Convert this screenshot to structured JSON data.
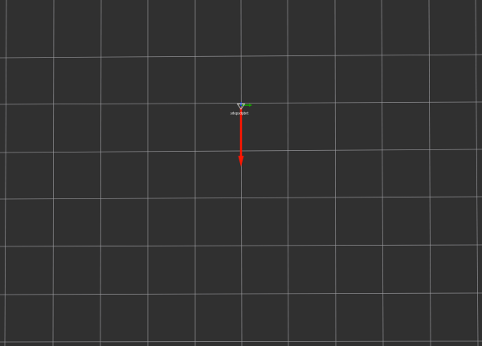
{
  "viewport": {
    "background_color": "#303030",
    "grid_color": "#a0a0a4"
  },
  "frame": {
    "label": "sdepsdpbrt",
    "x_axis_color": "#ff1500",
    "y_axis_color": "#19a000",
    "z_axis_color": "#0033ff"
  }
}
